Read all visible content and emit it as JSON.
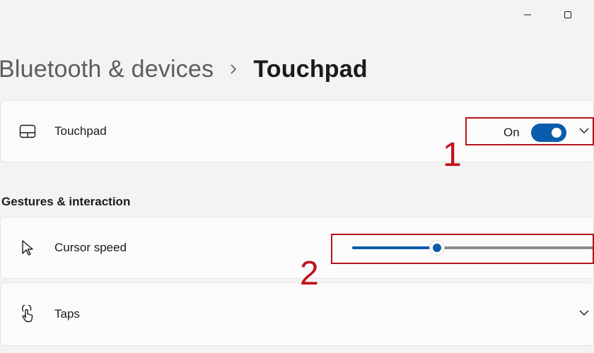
{
  "breadcrumb": {
    "parent": "Bluetooth & devices",
    "current": "Touchpad"
  },
  "touchpad_card": {
    "label": "Touchpad",
    "icon": "touchpad-icon",
    "toggle_state_text": "On",
    "toggle_on": true
  },
  "section": {
    "title": "Gestures & interaction"
  },
  "cursor_speed": {
    "label": "Cursor speed",
    "icon": "cursor-icon",
    "value_fraction": 0.35
  },
  "taps": {
    "label": "Taps",
    "icon": "tap-gesture-icon"
  },
  "annotations": {
    "one": "1",
    "two": "2"
  },
  "colors": {
    "accent": "#0b5cab",
    "annotation": "#b5141c"
  }
}
